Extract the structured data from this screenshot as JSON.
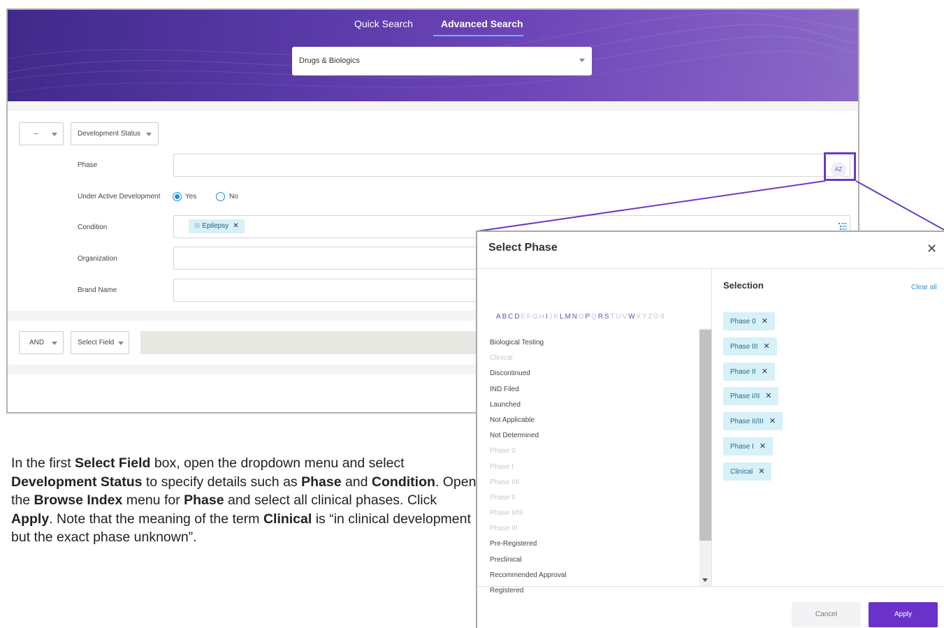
{
  "tabs": {
    "quick": "Quick Search",
    "advanced": "Advanced Search"
  },
  "database_select": {
    "value": "Drugs & Biologics"
  },
  "row1": {
    "operator": "–",
    "field": "Development Status",
    "labels": {
      "phase": "Phase",
      "active": "Under Active Development",
      "condition": "Condition",
      "organization": "Organization",
      "brand": "Brand Name"
    },
    "radio_yes": "Yes",
    "radio_no": "No",
    "condition_chip": "Epilepsy",
    "az_button": "AZ"
  },
  "row2": {
    "operator": "AND",
    "field": "Select Field"
  },
  "instruction": {
    "p1": "In the first ",
    "b1": "Select Field",
    "p2": " box, open the dropdown menu and select ",
    "b2": "Development Status",
    "p3": " to specify details such as ",
    "b3": "Phase",
    "p4": " and ",
    "b4": "Condition",
    "p5": ". Open the ",
    "b5": "Browse Index",
    "p6": " menu for ",
    "b6": "Phase",
    "p7": " and select all clinical phases. Click ",
    "b7": "Apply",
    "p8": ". Note that the meaning of the term ",
    "b8": "Clinical",
    "p9": " is “in clinical development but the exact phase unknown”."
  },
  "modal": {
    "title": "Select Phase",
    "close": "✕",
    "alphabet": [
      {
        "l": "A",
        "on": true
      },
      {
        "l": "B",
        "on": true
      },
      {
        "l": "C",
        "on": true
      },
      {
        "l": "D",
        "on": true
      },
      {
        "l": "E",
        "on": false
      },
      {
        "l": "F",
        "on": false
      },
      {
        "l": "G",
        "on": false
      },
      {
        "l": "H",
        "on": false
      },
      {
        "l": "I",
        "on": true
      },
      {
        "l": "J",
        "on": false
      },
      {
        "l": "K",
        "on": false
      },
      {
        "l": "L",
        "on": true
      },
      {
        "l": "M",
        "on": true
      },
      {
        "l": "N",
        "on": true
      },
      {
        "l": "O",
        "on": false
      },
      {
        "l": "P",
        "on": true
      },
      {
        "l": "Q",
        "on": false
      },
      {
        "l": "R",
        "on": true
      },
      {
        "l": "S",
        "on": true
      },
      {
        "l": "T",
        "on": false
      },
      {
        "l": "U",
        "on": false
      },
      {
        "l": "V",
        "on": false
      },
      {
        "l": "W",
        "on": true
      },
      {
        "l": "X",
        "on": false
      },
      {
        "l": "Y",
        "on": false
      },
      {
        "l": "Z",
        "on": false
      },
      {
        "l": "0-9",
        "on": false
      }
    ],
    "index_items": [
      {
        "t": "Biological Testing",
        "dim": false
      },
      {
        "t": "Clinical",
        "dim": true
      },
      {
        "t": "Discontinued",
        "dim": false
      },
      {
        "t": "IND Filed",
        "dim": false
      },
      {
        "t": "Launched",
        "dim": false
      },
      {
        "t": "Not Applicable",
        "dim": false
      },
      {
        "t": "Not Determined",
        "dim": false
      },
      {
        "t": "Phase 0",
        "dim": true
      },
      {
        "t": "Phase I",
        "dim": true
      },
      {
        "t": "Phase I/II",
        "dim": true
      },
      {
        "t": "Phase II",
        "dim": true
      },
      {
        "t": "Phase II/III",
        "dim": true
      },
      {
        "t": "Phase III",
        "dim": true
      },
      {
        "t": "Pre-Registered",
        "dim": false
      },
      {
        "t": "Preclinical",
        "dim": false
      },
      {
        "t": "Recommended Approval",
        "dim": false
      },
      {
        "t": "Registered",
        "dim": false
      }
    ],
    "selection_title": "Selection",
    "clear_all": "Clear all",
    "selected": [
      "Phase 0",
      "Phase III",
      "Phase II",
      "Phase I/II",
      "Phase II/III",
      "Phase I",
      "Clinical"
    ],
    "cancel": "Cancel",
    "apply": "Apply"
  }
}
